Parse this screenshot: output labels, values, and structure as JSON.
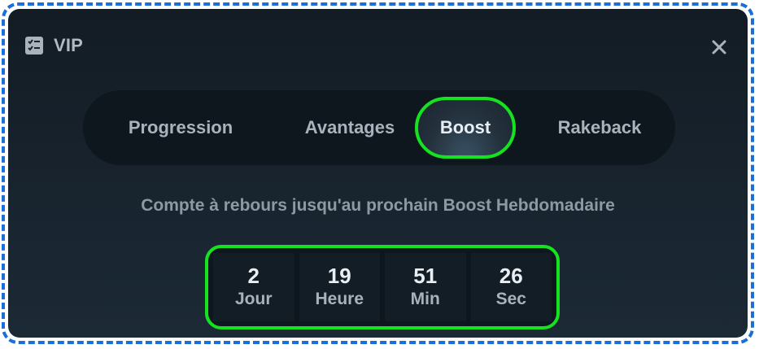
{
  "modal": {
    "title": "VIP",
    "icon": "vip-list-icon",
    "close_icon": "close-icon"
  },
  "tabs": [
    {
      "label": "Progression",
      "active": false
    },
    {
      "label": "Avantages",
      "active": false
    },
    {
      "label": "Boost",
      "active": true
    },
    {
      "label": "Rakeback",
      "active": false
    }
  ],
  "boost": {
    "subtitle": "Compte à rebours jusqu'au prochain Boost Hebdomadaire",
    "countdown": [
      {
        "value": "2",
        "label": "Jour"
      },
      {
        "value": "19",
        "label": "Heure"
      },
      {
        "value": "51",
        "label": "Min"
      },
      {
        "value": "26",
        "label": "Sec"
      }
    ]
  },
  "colors": {
    "highlight": "#16e31f",
    "frame_border": "#1b6fd6",
    "background": "#17222c"
  }
}
